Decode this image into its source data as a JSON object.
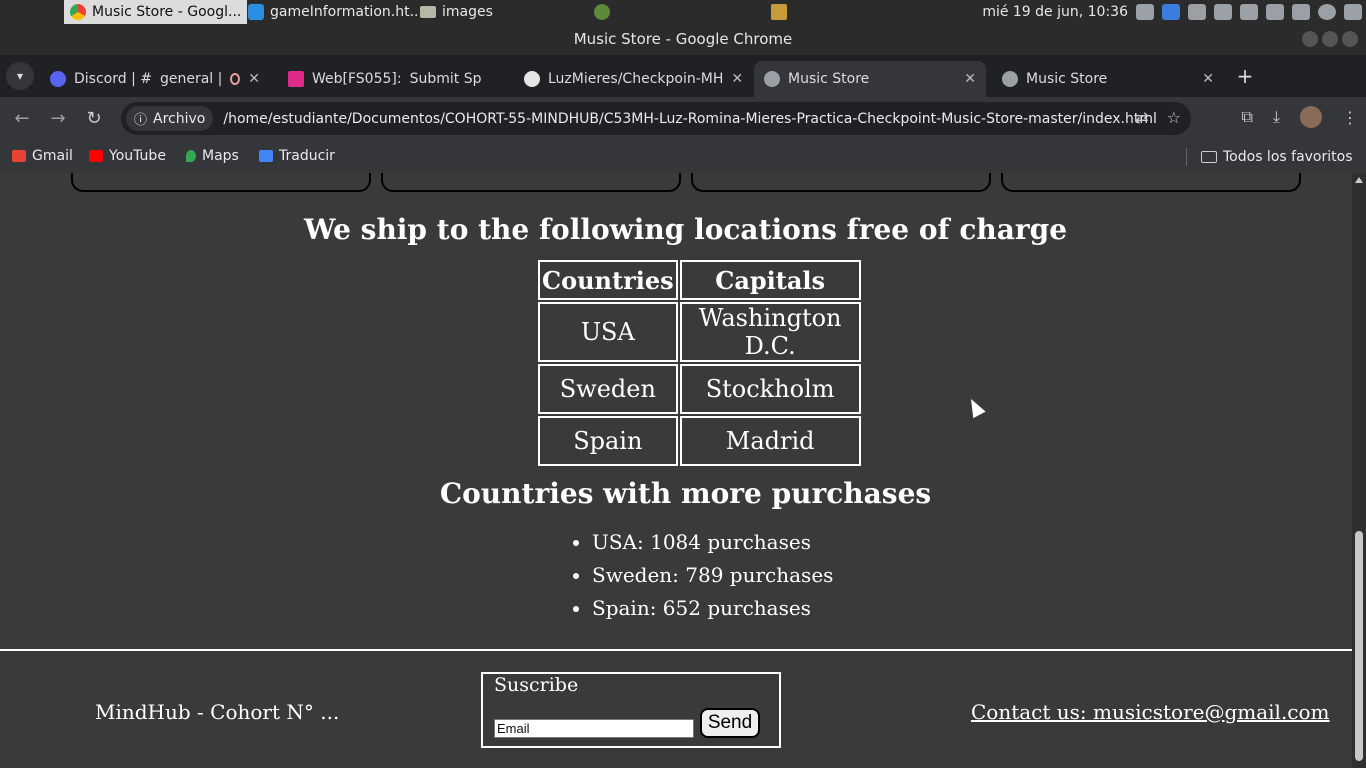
{
  "taskbar": {
    "tasks": [
      {
        "label": "Music Store - Googl..."
      },
      {
        "label": "gameInformation.ht..."
      },
      {
        "label": "images"
      }
    ],
    "clock": "mié 19 de jun, 10:36"
  },
  "window": {
    "title": "Music Store - Google Chrome"
  },
  "tabs": [
    {
      "label": "Discord | #",
      "label2": "general |"
    },
    {
      "label": "Web[FS055]:",
      "label2": "Submit Sp"
    },
    {
      "label": "LuzMieres/Checkpoin-MH"
    },
    {
      "label": "Music Store"
    },
    {
      "label": "Music Store"
    }
  ],
  "toolbar": {
    "chip": "Archivo",
    "url": "/home/estudiante/Documentos/COHORT-55-MINDHUB/C53MH-Luz-Romina-Mieres-Practica-Checkpoint-Music-Store-master/index.html"
  },
  "bookmarks": {
    "items": [
      {
        "label": "Gmail"
      },
      {
        "label": "YouTube"
      },
      {
        "label": "Maps"
      },
      {
        "label": "Traducir"
      }
    ],
    "all": "Todos los favoritos"
  },
  "page": {
    "ship_title": "We ship to the following locations free of charge",
    "table": {
      "headers": [
        "Countries",
        "Capitals"
      ],
      "rows": [
        [
          "USA",
          "Washington D.C."
        ],
        [
          "Sweden",
          "Stockholm"
        ],
        [
          "Spain",
          "Madrid"
        ]
      ]
    },
    "purchases_title": "Countries with more purchases",
    "purchases": [
      "USA: 1084 purchases",
      "Sweden: 789 purchases",
      "Spain: 652 purchases"
    ],
    "footer": {
      "left": "MindHub - Cohort N° ...",
      "subscribe_legend": "Suscribe",
      "email_placeholder": "Email",
      "send_label": "Send",
      "contact": "Contact us: musicstore@gmail.com"
    }
  }
}
